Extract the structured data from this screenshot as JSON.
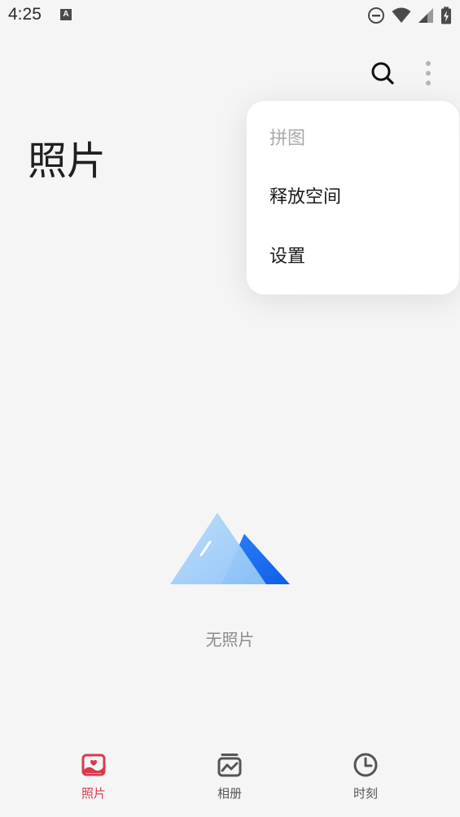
{
  "status_bar": {
    "time": "4:25",
    "notification_icon": "A"
  },
  "toolbar": {
    "search_icon": "search-icon",
    "more_icon": "more-vertical-icon"
  },
  "page": {
    "title": "照片"
  },
  "menu": {
    "items": [
      {
        "label": "拼图",
        "enabled": false
      },
      {
        "label": "释放空间",
        "enabled": true
      },
      {
        "label": "设置",
        "enabled": true
      }
    ]
  },
  "empty_state": {
    "text": "无照片",
    "illustration": "mountain-illustration"
  },
  "bottom_nav": {
    "items": [
      {
        "label": "照片",
        "icon": "photo-icon",
        "active": true
      },
      {
        "label": "相册",
        "icon": "album-icon",
        "active": false
      },
      {
        "label": "时刻",
        "icon": "clock-icon",
        "active": false
      }
    ]
  },
  "colors": {
    "background": "#f5f5f5",
    "accent": "#d83a4d",
    "inactive": "#555555",
    "mountain_light": "#a9d1fa",
    "mountain_dark": "#1a6df5"
  }
}
